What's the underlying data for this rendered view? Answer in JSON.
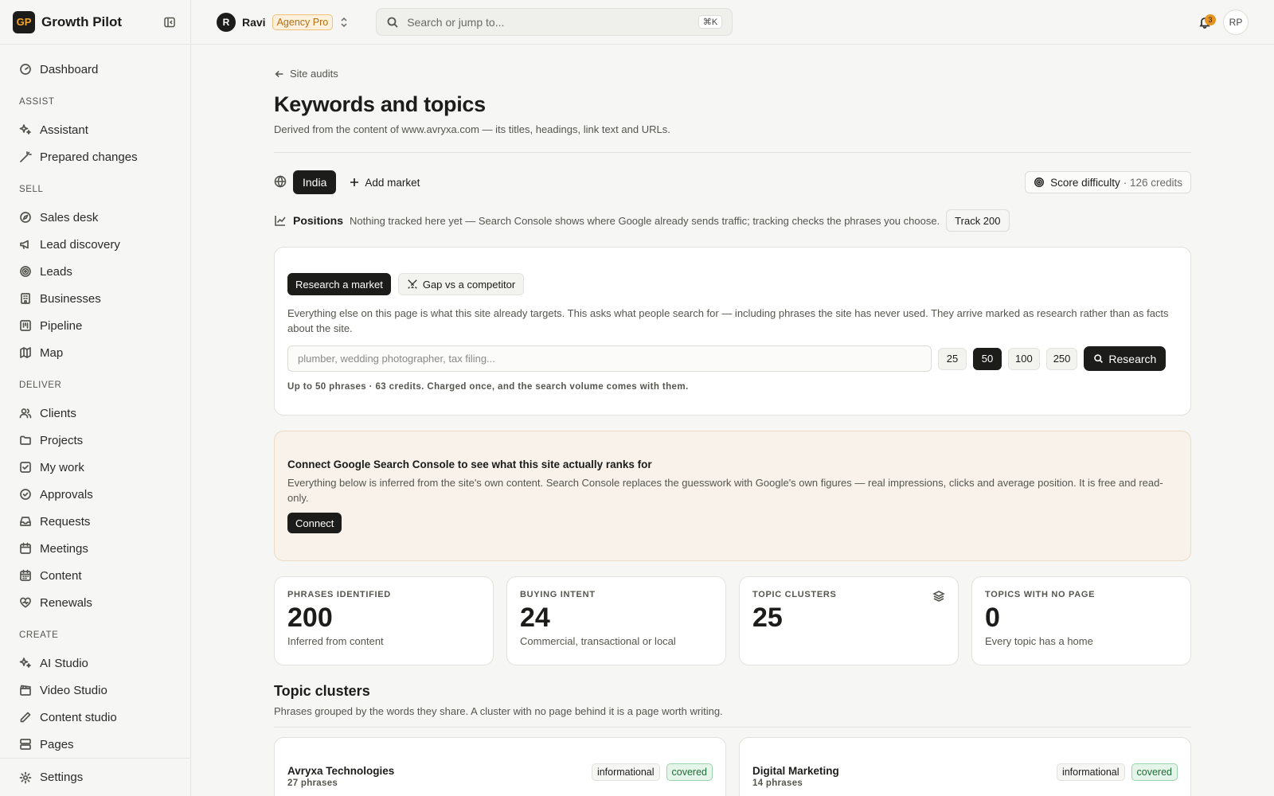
{
  "brand": {
    "logo": "GP",
    "name": "Growth Pilot"
  },
  "sidebar": {
    "top": [
      {
        "label": "Dashboard",
        "icon": "gauge-icon"
      }
    ],
    "sections": [
      {
        "title": "ASSIST",
        "items": [
          {
            "label": "Assistant",
            "icon": "sparkles-icon"
          },
          {
            "label": "Prepared changes",
            "icon": "wand-icon"
          }
        ]
      },
      {
        "title": "SELL",
        "items": [
          {
            "label": "Sales desk",
            "icon": "compass-icon"
          },
          {
            "label": "Lead discovery",
            "icon": "megaphone-icon"
          },
          {
            "label": "Leads",
            "icon": "target-icon"
          },
          {
            "label": "Businesses",
            "icon": "building-icon"
          },
          {
            "label": "Pipeline",
            "icon": "kanban-icon"
          },
          {
            "label": "Map",
            "icon": "map-icon"
          }
        ]
      },
      {
        "title": "DELIVER",
        "items": [
          {
            "label": "Clients",
            "icon": "users-icon"
          },
          {
            "label": "Projects",
            "icon": "folder-icon"
          },
          {
            "label": "My work",
            "icon": "checkbox-icon"
          },
          {
            "label": "Approvals",
            "icon": "check-circle-icon"
          },
          {
            "label": "Requests",
            "icon": "inbox-icon"
          },
          {
            "label": "Meetings",
            "icon": "calendar-icon"
          },
          {
            "label": "Content",
            "icon": "calendar-grid-icon"
          },
          {
            "label": "Renewals",
            "icon": "heart-icon"
          }
        ]
      },
      {
        "title": "CREATE",
        "items": [
          {
            "label": "AI Studio",
            "icon": "sparkles-icon"
          },
          {
            "label": "Video Studio",
            "icon": "clapperboard-icon"
          },
          {
            "label": "Content studio",
            "icon": "pen-icon"
          },
          {
            "label": "Pages",
            "icon": "layout-icon"
          }
        ]
      }
    ],
    "footer": {
      "label": "Settings",
      "icon": "gear-icon"
    }
  },
  "topbar": {
    "workspace_initial": "R",
    "workspace_name": "Ravi",
    "plan": "Agency Pro",
    "search_placeholder": "Search or jump to...",
    "shortcut": "⌘K",
    "notifications": "3",
    "user_initials": "RP"
  },
  "page": {
    "breadcrumb": "Site audits",
    "title": "Keywords and topics",
    "subtitle": "Derived from the content of www.avryxa.com — its titles, headings, link text and URLs.",
    "market": "India",
    "add_market": "Add market",
    "score_label": "Score difficulty",
    "score_credits": "· 126 credits",
    "positions_label": "Positions",
    "positions_desc": "Nothing tracked here yet — Search Console shows where Google already sends traffic; tracking checks the phrases you choose.",
    "track_label": "Track 200"
  },
  "research": {
    "tab_active": "Research a market",
    "tab_gap": "Gap vs a competitor",
    "description": "Everything else on this page is what this site already targets. This asks what people search for — including phrases the site has never used. They arrive marked as research rather than as facts about the site.",
    "placeholder": "plumber, wedding photographer, tax filing...",
    "counts": [
      "25",
      "50",
      "100",
      "250"
    ],
    "selected_count": "50",
    "button": "Research",
    "note": "Up to 50 phrases · 63 credits. Charged once, and the search volume comes with them."
  },
  "gsc": {
    "title": "Connect Google Search Console to see what this site actually ranks for",
    "description": "Everything below is inferred from the site's own content. Search Console replaces the guesswork with Google's own figures — real impressions, clicks and average position. It is free and read-only.",
    "button": "Connect"
  },
  "stats": [
    {
      "label": "PHRASES IDENTIFIED",
      "value": "200",
      "sub": "Inferred from content"
    },
    {
      "label": "BUYING INTENT",
      "value": "24",
      "sub": "Commercial, transactional or local"
    },
    {
      "label": "TOPIC CLUSTERS",
      "value": "25",
      "sub": ""
    },
    {
      "label": "TOPICS WITH NO PAGE",
      "value": "0",
      "sub": "Every topic has a home"
    }
  ],
  "clusters_section": {
    "title": "Topic clusters",
    "subtitle": "Phrases grouped by the words they share. A cluster with no page behind it is a page worth writing.",
    "items": [
      {
        "name": "Avryxa Technologies",
        "count": "27 phrases",
        "intent": "informational",
        "status": "covered"
      },
      {
        "name": "Digital Marketing",
        "count": "14 phrases",
        "intent": "informational",
        "status": "covered"
      }
    ]
  }
}
